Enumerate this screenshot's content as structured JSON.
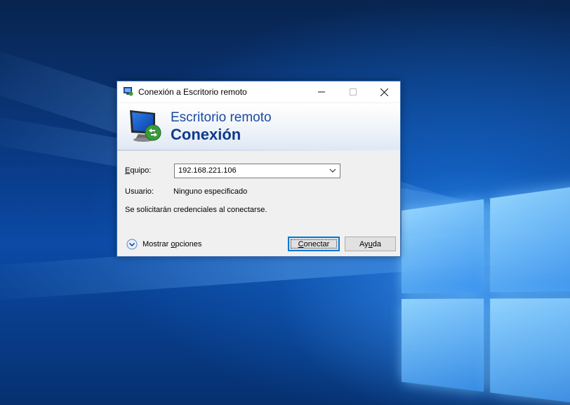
{
  "window": {
    "title": "Conexión a Escritorio remoto",
    "controls": {
      "minimize_icon": "minimize-icon",
      "maximize_icon": "maximize-icon",
      "close_icon": "close-icon"
    }
  },
  "banner": {
    "line1": "Escritorio remoto",
    "line2": "Conexión",
    "icon": "remote-desktop-monitor-icon"
  },
  "form": {
    "computer_label_prefix": "E",
    "computer_label_rest": "quipo:",
    "computer_value": "192.168.221.106",
    "user_label": "Usuario:",
    "user_value": "Ninguno especificado",
    "credentials_note": "Se solicitarán credenciales al conectarse."
  },
  "footer": {
    "show_options_pre": "Mostrar ",
    "show_options_u": "o",
    "show_options_post": "pciones",
    "connect_u": "C",
    "connect_rest": "onectar",
    "help_pre": "Ay",
    "help_u": "u",
    "help_post": "da"
  },
  "colors": {
    "accent": "#0078d7",
    "banner_text": "#1a4aa0",
    "desktop": "#0b4aa6"
  }
}
